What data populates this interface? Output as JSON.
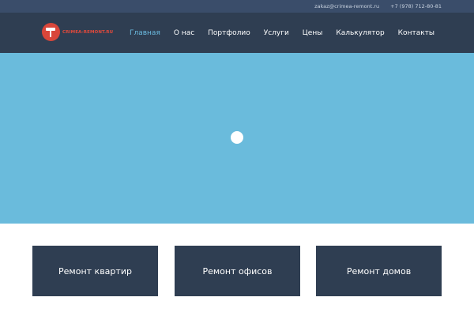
{
  "topbar": {
    "email": "zakaz@crimea-remont.ru",
    "phone": "+7 (978) 712-80-81"
  },
  "header": {
    "logo_text": "CRIMEA-REMONT.RU",
    "nav": [
      {
        "label": "Главная",
        "active": true
      },
      {
        "label": "О нас"
      },
      {
        "label": "Портфолио"
      },
      {
        "label": "Услуги"
      },
      {
        "label": "Цены"
      },
      {
        "label": "Калькулятор"
      },
      {
        "label": "Контакты"
      }
    ]
  },
  "cards": [
    {
      "label": "Ремонт квартир"
    },
    {
      "label": "Ремонт офисов"
    },
    {
      "label": "Ремонт домов"
    }
  ],
  "colors": {
    "topbar_bg": "#3a4d6a",
    "header_bg": "#2f3e52",
    "nav_active": "#6bbbe0",
    "hero_bg": "#6abbdc",
    "logo_red": "#d9463a"
  }
}
